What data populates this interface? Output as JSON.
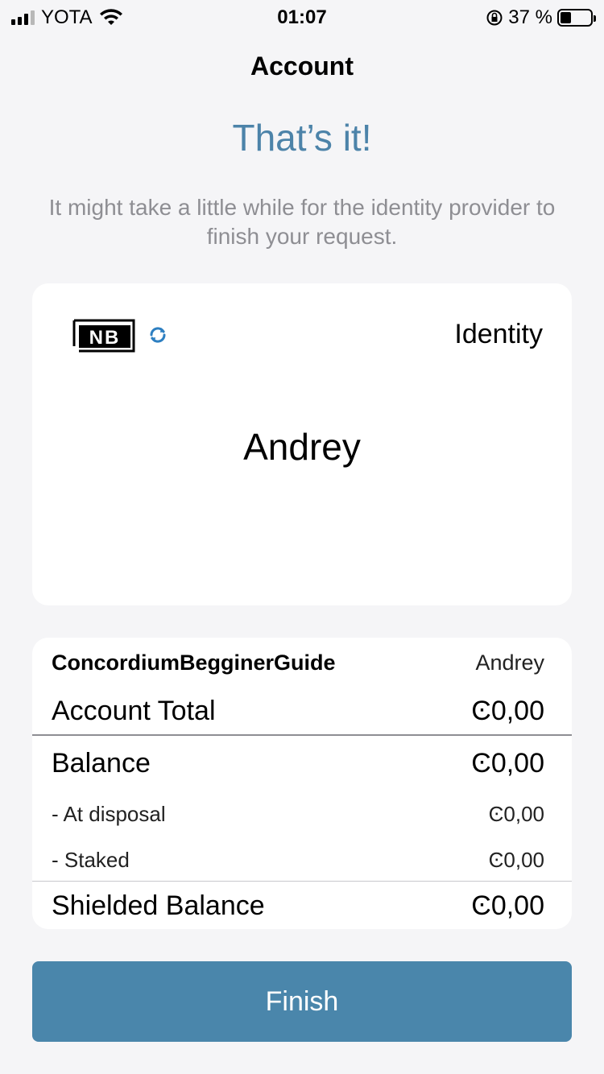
{
  "status_bar": {
    "carrier": "YOTA",
    "time": "01:07",
    "battery_percent": "37 %",
    "battery_level": 0.37,
    "icons": [
      "signal-icon",
      "wifi-icon",
      "orientation-lock-icon",
      "battery-icon"
    ]
  },
  "nav": {
    "title": "Account"
  },
  "headline": "That’s it!",
  "subtitle": "It might take a little while for the identity provider to finish your request.",
  "identity_card": {
    "logo": "NB",
    "status_icon": "refresh-icon",
    "label": "Identity",
    "name": "Andrey"
  },
  "account_card": {
    "account_name": "ConcordiumBegginerGuide",
    "owner": "Andrey",
    "rows": {
      "account_total": {
        "label": "Account Total",
        "value": "Ͼ0,00"
      },
      "balance": {
        "label": "Balance",
        "value": "Ͼ0,00"
      },
      "at_disposal": {
        "label": "- At disposal",
        "value": "Ͼ0,00"
      },
      "staked": {
        "label": "- Staked",
        "value": "Ͼ0,00"
      },
      "shielded_balance": {
        "label": "Shielded Balance",
        "value": "Ͼ0,00"
      }
    }
  },
  "finish_button": {
    "label": "Finish"
  },
  "colors": {
    "accent": "#4a86ab",
    "headline": "#4c83a9",
    "muted": "#8e8e93",
    "background": "#f5f5f7"
  }
}
